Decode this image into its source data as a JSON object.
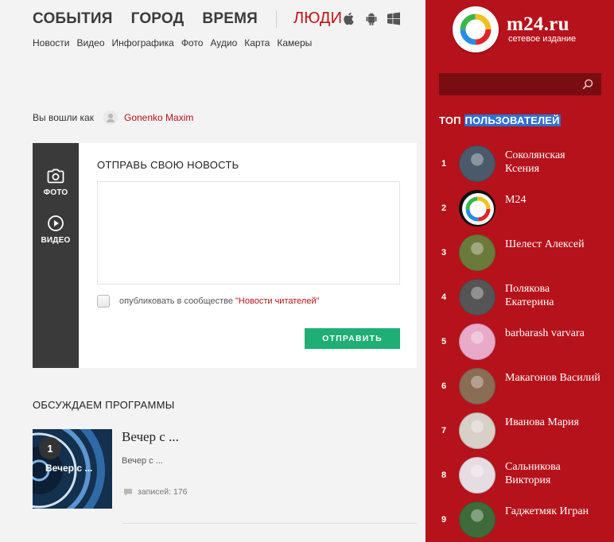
{
  "nav": {
    "items": [
      "СОБЫТИЯ",
      "ГОРОД",
      "ВРЕМЯ"
    ],
    "people": "ЛЮДИ",
    "platform_icons": [
      "apple-icon",
      "android-icon",
      "windows-icon"
    ]
  },
  "subnav": [
    "Новости",
    "Видео",
    "Инфографика",
    "Фото",
    "Аудио",
    "Карта",
    "Камеры"
  ],
  "login": {
    "prefix": "Вы вошли как",
    "user": "Gonenko Maxim"
  },
  "submit": {
    "title": "ОТПРАВЬ СВОЮ НОВОСТЬ",
    "photo_label": "ФОТО",
    "video_label": "ВИДЕО",
    "text_value": "",
    "publish_text": "опубликовать в сообществе",
    "community": "\"Новости читателей\"",
    "publish_checked": false,
    "send_label": "ОТПРАВИТЬ"
  },
  "programs": {
    "title": "ОБСУЖДАЕМ ПРОГРАММЫ",
    "items": [
      {
        "rank": "1",
        "title": "Вечер с ...",
        "desc": "Вечер с ...",
        "thumb_text": "Вечер с ...",
        "count": "записей: 176"
      }
    ]
  },
  "sidebar": {
    "logo_name": "m24.ru",
    "logo_tag": "сетевое издание",
    "search_placeholder": "",
    "top_title_1": "ТОП",
    "top_title_2": "ПОЛЬЗОВАТЕЛЕЙ",
    "users": [
      {
        "num": "1",
        "name": "Соколянская Ксения",
        "color": "#4a5a6a"
      },
      {
        "num": "2",
        "name": "M24",
        "color": "#111111"
      },
      {
        "num": "3",
        "name": "Шелест Алексей",
        "color": "#6b7a3a"
      },
      {
        "num": "4",
        "name": "Полякова Екатерина",
        "color": "#555555"
      },
      {
        "num": "5",
        "name": "barbarash varvara",
        "color": "#e9a9c9"
      },
      {
        "num": "6",
        "name": "Макагонов Василий",
        "color": "#8a6d55"
      },
      {
        "num": "7",
        "name": "Иванова Мария",
        "color": "#d8cfc8"
      },
      {
        "num": "8",
        "name": "Сальникова Виктория",
        "color": "#e6dde2"
      },
      {
        "num": "9",
        "name": "Гаджетмяк Игран",
        "color": "#3f6b3a"
      }
    ]
  },
  "colors": {
    "brand_red": "#b5121b",
    "send_green": "#1fae75",
    "side_dark": "#3a3a3a",
    "highlight_blue": "#2f6fd0"
  }
}
